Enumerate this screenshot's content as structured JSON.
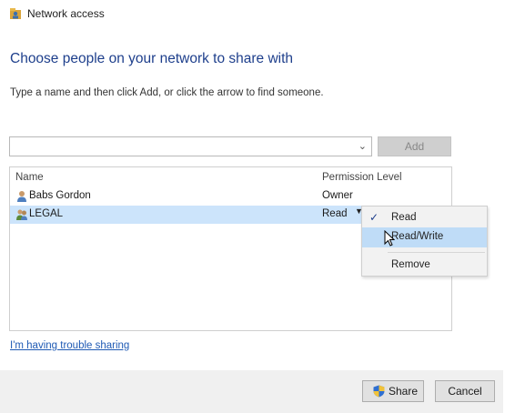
{
  "window": {
    "title": "Network access",
    "icon": "network-share-icon"
  },
  "page": {
    "heading": "Choose people on your network to share with",
    "instruction": "Type a name and then click Add, or click the arrow to find someone."
  },
  "name_input": {
    "value": "",
    "dropdown_icon": "chevron-down-icon"
  },
  "add_button": {
    "label": "Add",
    "enabled": false
  },
  "share_list": {
    "columns": [
      "Name",
      "Permission Level"
    ],
    "rows": [
      {
        "name": "Babs Gordon",
        "permission": "Owner",
        "icon": "user-icon",
        "selected": false
      },
      {
        "name": "LEGAL",
        "permission": "Read",
        "icon": "group-icon",
        "selected": true,
        "has_dropdown": true
      }
    ]
  },
  "permission_menu": {
    "items": [
      {
        "label": "Read",
        "checked": true
      },
      {
        "label": "Read/Write",
        "highlighted": true
      },
      {
        "label": "Remove"
      }
    ]
  },
  "links": {
    "trouble": "I'm having trouble sharing"
  },
  "footer": {
    "share_label": "Share",
    "cancel_label": "Cancel"
  },
  "colors": {
    "heading": "#1e3f8c",
    "selection": "#cce4fb",
    "menu_highlight": "#bfdcf7",
    "link": "#1f5ab4"
  }
}
